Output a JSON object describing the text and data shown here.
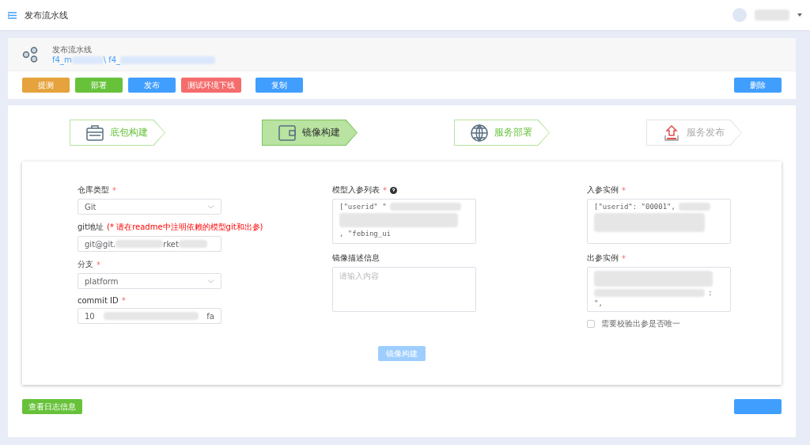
{
  "topbar": {
    "title": "发布流水线"
  },
  "pipeline": {
    "title": "发布流水线",
    "path_parts": [
      "f4_m",
      "\\ f4_"
    ]
  },
  "actions": [
    {
      "label": "提测",
      "kind": "warning"
    },
    {
      "label": "部署",
      "kind": "success"
    },
    {
      "label": "发布",
      "kind": "primary"
    },
    {
      "label": "测试环境下线",
      "kind": "danger"
    },
    {
      "label": "复制",
      "kind": "primary"
    }
  ],
  "delete_button": {
    "label": "删除"
  },
  "steps": [
    {
      "label": "底包构建",
      "selected": false,
      "disabled": false
    },
    {
      "label": "镜像构建",
      "selected": true,
      "disabled": false
    },
    {
      "label": "服务部署",
      "selected": false,
      "disabled": false
    },
    {
      "label": "服务发布",
      "selected": false,
      "disabled": true
    }
  ],
  "form": {
    "repo_type": {
      "label": "仓库类型",
      "required_mark": "*",
      "value": "Git"
    },
    "git_url": {
      "label": "git地址",
      "hint": "(* 请在readme中注明依赖的模型git和出参)",
      "value_parts": [
        "git@git.",
        "rket"
      ]
    },
    "branch": {
      "label": "分支",
      "required_mark": "*",
      "value": "platform"
    },
    "commit": {
      "label": "commit ID",
      "required_mark": "*",
      "value_parts": [
        "10",
        "fa"
      ]
    },
    "model_params": {
      "label": "模型入参列表",
      "required_mark": "*",
      "lines": [
        "[\"userid\" \"",
        ", \"febing_ui"
      ]
    },
    "image_desc": {
      "label": "镜像描述信息",
      "placeholder": "请输入内容"
    },
    "input_example": {
      "label": "入参实例",
      "required_mark": "*",
      "lines": [
        "[\"userid\": \"00001\","
      ]
    },
    "output_example": {
      "label": "出参实例",
      "required_mark": "*",
      "lines": [
        ":",
        "\","
      ]
    },
    "unique_check": {
      "label": "需要校验出参是否唯一",
      "checked": false
    },
    "build_button": {
      "label": "镜像构建",
      "disabled": true
    }
  },
  "log_button": {
    "label": "查看日志信息"
  }
}
